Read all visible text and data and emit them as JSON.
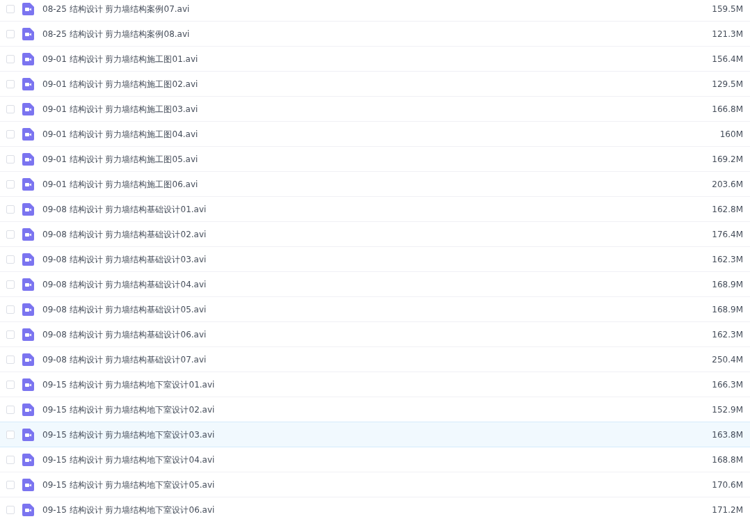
{
  "files": [
    {
      "name": "08-25 结构设计 剪力墙结构案例07.avi",
      "size": "159.5M",
      "checked": false,
      "highlighted": false
    },
    {
      "name": "08-25 结构设计 剪力墙结构案例08.avi",
      "size": "121.3M",
      "checked": false,
      "highlighted": false
    },
    {
      "name": "09-01 结构设计 剪力墙结构施工图01.avi",
      "size": "156.4M",
      "checked": false,
      "highlighted": false
    },
    {
      "name": "09-01 结构设计 剪力墙结构施工图02.avi",
      "size": "129.5M",
      "checked": false,
      "highlighted": false
    },
    {
      "name": "09-01 结构设计 剪力墙结构施工图03.avi",
      "size": "166.8M",
      "checked": false,
      "highlighted": false
    },
    {
      "name": "09-01 结构设计 剪力墙结构施工图04.avi",
      "size": "160M",
      "checked": false,
      "highlighted": false
    },
    {
      "name": "09-01 结构设计 剪力墙结构施工图05.avi",
      "size": "169.2M",
      "checked": false,
      "highlighted": false
    },
    {
      "name": "09-01 结构设计 剪力墙结构施工图06.avi",
      "size": "203.6M",
      "checked": false,
      "highlighted": false
    },
    {
      "name": "09-08 结构设计 剪力墙结构基础设计01.avi",
      "size": "162.8M",
      "checked": false,
      "highlighted": false
    },
    {
      "name": "09-08 结构设计 剪力墙结构基础设计02.avi",
      "size": "176.4M",
      "checked": false,
      "highlighted": false
    },
    {
      "name": "09-08 结构设计 剪力墙结构基础设计03.avi",
      "size": "162.3M",
      "checked": false,
      "highlighted": false
    },
    {
      "name": "09-08 结构设计 剪力墙结构基础设计04.avi",
      "size": "168.9M",
      "checked": false,
      "highlighted": false
    },
    {
      "name": "09-08 结构设计 剪力墙结构基础设计05.avi",
      "size": "168.9M",
      "checked": false,
      "highlighted": false
    },
    {
      "name": "09-08 结构设计 剪力墙结构基础设计06.avi",
      "size": "162.3M",
      "checked": false,
      "highlighted": false
    },
    {
      "name": "09-08 结构设计 剪力墙结构基础设计07.avi",
      "size": "250.4M",
      "checked": false,
      "highlighted": false
    },
    {
      "name": "09-15 结构设计 剪力墙结构地下室设计01.avi",
      "size": "166.3M",
      "checked": false,
      "highlighted": false
    },
    {
      "name": "09-15 结构设计 剪力墙结构地下室设计02.avi",
      "size": "152.9M",
      "checked": false,
      "highlighted": false
    },
    {
      "name": "09-15 结构设计 剪力墙结构地下室设计03.avi",
      "size": "163.8M",
      "checked": false,
      "highlighted": true
    },
    {
      "name": "09-15 结构设计 剪力墙结构地下室设计04.avi",
      "size": "168.8M",
      "checked": false,
      "highlighted": false
    },
    {
      "name": "09-15 结构设计 剪力墙结构地下室设计05.avi",
      "size": "170.6M",
      "checked": false,
      "highlighted": false
    },
    {
      "name": "09-15 结构设计 剪力墙结构地下室设计06.avi",
      "size": "171.2M",
      "checked": false,
      "highlighted": false
    }
  ]
}
